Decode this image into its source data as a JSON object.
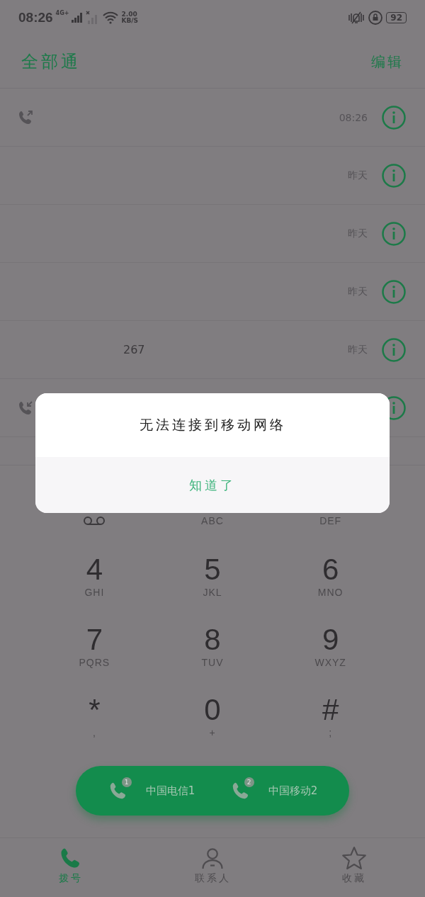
{
  "status_bar": {
    "time": "08:26",
    "network": "4G+",
    "speed_value": "2.00",
    "speed_unit": "KB/S",
    "battery": "92"
  },
  "header": {
    "title": "全部通",
    "action": "编辑"
  },
  "calls": [
    {
      "kind": "outgoing",
      "time": "08:26"
    },
    {
      "time": "昨天"
    },
    {
      "time": "昨天"
    },
    {
      "time": "昨天"
    },
    {
      "number": "267",
      "time": "昨天"
    },
    {
      "kind": "incoming"
    }
  ],
  "dialog": {
    "message": "无法连接到移动网络",
    "button": "知道了"
  },
  "keypad": [
    {
      "kind": "voicemail"
    },
    {
      "letters": "ABC"
    },
    {
      "letters": "DEF"
    },
    {
      "digit": "4",
      "letters": "GHI"
    },
    {
      "digit": "5",
      "letters": "JKL"
    },
    {
      "digit": "6",
      "letters": "MNO"
    },
    {
      "digit": "7",
      "letters": "PQRS"
    },
    {
      "digit": "8",
      "letters": "TUV"
    },
    {
      "digit": "9",
      "letters": "WXYZ"
    },
    {
      "digit": "*",
      "letters": ","
    },
    {
      "digit": "0",
      "letters": "+"
    },
    {
      "digit": "#",
      "letters": ";"
    }
  ],
  "sims": [
    {
      "badge": "1",
      "label": "中国电信1"
    },
    {
      "badge": "2",
      "label": "中国移动2"
    }
  ],
  "nav": [
    {
      "kind": "phone",
      "label": "拨号",
      "selected": true
    },
    {
      "kind": "person",
      "label": "联系人",
      "selected": false
    },
    {
      "kind": "star",
      "label": "收藏",
      "selected": false
    }
  ]
}
